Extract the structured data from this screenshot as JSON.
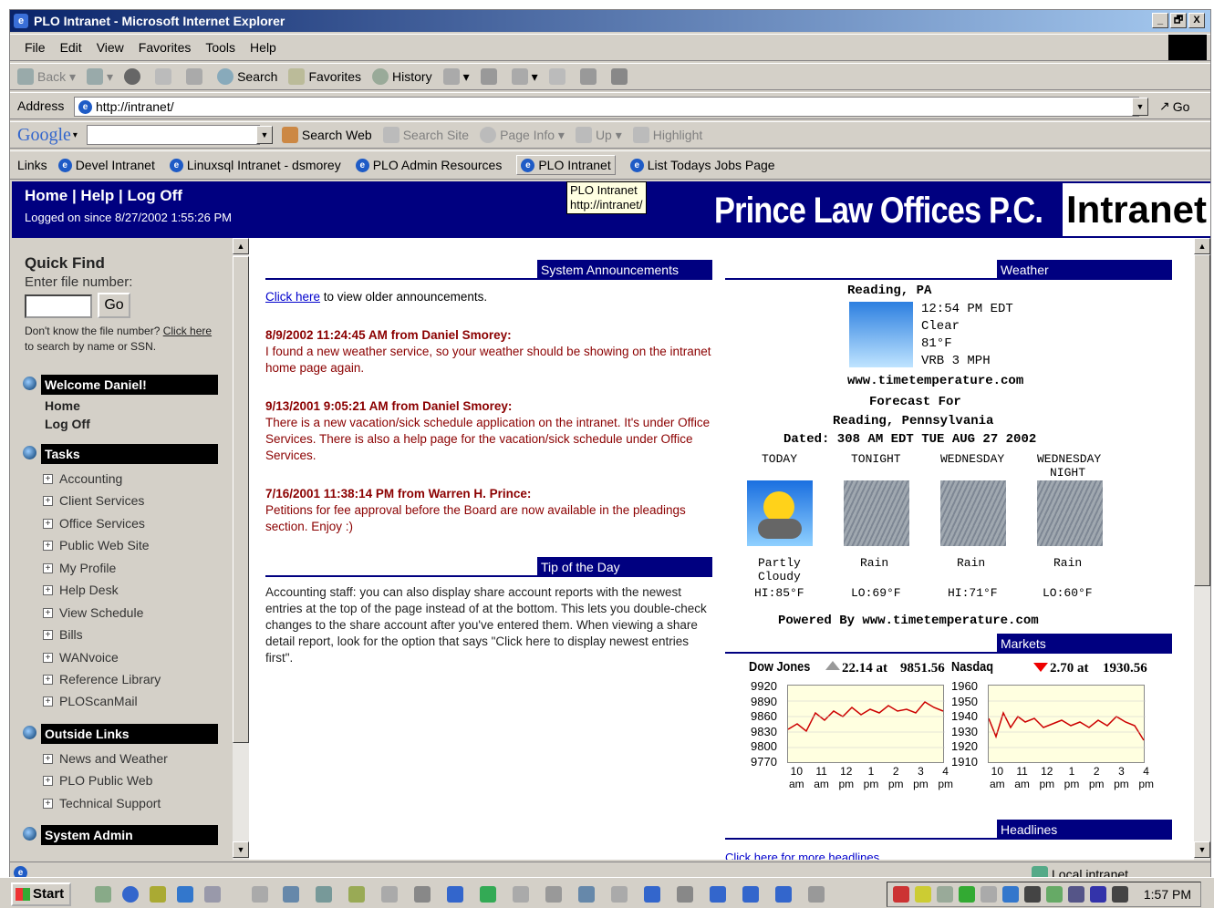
{
  "window": {
    "title": "PLO Intranet - Microsoft Internet Explorer",
    "min": "_",
    "max": "🗗",
    "close": "X"
  },
  "menu": [
    "File",
    "Edit",
    "View",
    "Favorites",
    "Tools",
    "Help"
  ],
  "toolbar": {
    "back": "Back",
    "search": "Search",
    "favorites": "Favorites",
    "history": "History"
  },
  "address": {
    "label": "Address",
    "url": "http://intranet/",
    "go": "Go"
  },
  "google": {
    "logo": "Google",
    "search_web": "Search Web",
    "search_site": "Search Site",
    "page_info": "Page Info",
    "up": "Up",
    "highlight": "Highlight"
  },
  "links": {
    "label": "Links",
    "items": [
      "Devel Intranet",
      "Linuxsql Intranet - dsmorey",
      "PLO Admin Resources",
      "PLO Intranet",
      "List Todays Jobs Page"
    ]
  },
  "tooltip": {
    "line1": "PLO Intranet",
    "line2": "http://intranet/"
  },
  "header": {
    "nav": "Home | Help | Log Off",
    "logon": "Logged on since 8/27/2002 1:55:26 PM",
    "brand": "Prince Law Offices P.C.",
    "intranet": "Intranet"
  },
  "sidebar": {
    "quickfind": "Quick Find",
    "enter": "Enter file number:",
    "go": "Go",
    "dontknow": "Don't know the file number?",
    "clickhere": "Click here",
    "tosearch": "to search by name or SSN.",
    "welcome": "Welcome Daniel!",
    "home": "Home",
    "logoff": "Log Off",
    "tasks": "Tasks",
    "task_items": [
      "Accounting",
      "Client Services",
      "Office Services",
      "Public Web Site",
      "My Profile",
      "Help Desk",
      "View Schedule",
      "Bills",
      "WANvoice",
      "Reference Library",
      "PLOScanMail"
    ],
    "outside": "Outside Links",
    "outside_items": [
      "News and Weather",
      "PLO Public Web",
      "Technical Support"
    ],
    "sysadmin": "System Admin"
  },
  "announcements": {
    "title": "System Announcements",
    "clickhere": "Click here",
    "older": " to view older announcements.",
    "items": [
      {
        "head": "8/9/2002 11:24:45 AM from Daniel Smorey:",
        "body": "I found a new weather service, so your weather should be showing on the intranet home page again."
      },
      {
        "head": "9/13/2001 9:05:21 AM from Daniel Smorey:",
        "body": "There is a new vacation/sick schedule application on the intranet. It's under Office Services. There is also a help page for the vacation/sick schedule under Office Services."
      },
      {
        "head": "7/16/2001 11:38:14 PM from Warren H. Prince:",
        "body": "Petitions for fee approval before the Board are now available in the pleadings section. Enjoy :)"
      }
    ]
  },
  "tip": {
    "title": "Tip of the Day",
    "body": "Accounting staff: you can also display share account reports with the newest entries at the top of the page instead of at the bottom. This lets you double-check changes to the share account after you've entered them. When viewing a share detail report, look for the option that says \"Click here to display newest entries first\"."
  },
  "weather": {
    "title": "Weather",
    "city": "Reading, PA",
    "time": "12:54 PM EDT",
    "cond": "Clear",
    "temp": "81°F",
    "wind": "VRB 3 MPH",
    "site": "www.timetemperature.com",
    "forecast_for": "Forecast For",
    "location": "Reading, Pennsylvania",
    "dated": "Dated: 308 AM EDT TUE AUG 27 2002",
    "days": [
      {
        "name": "TODAY",
        "name2": "",
        "cond": "Partly",
        "cond2": "Cloudy",
        "temp": "HI:85°F"
      },
      {
        "name": "TONIGHT",
        "name2": "",
        "cond": "Rain",
        "cond2": "",
        "temp": "LO:69°F"
      },
      {
        "name": "WEDNESDAY",
        "name2": "",
        "cond": "Rain",
        "cond2": "",
        "temp": "HI:71°F"
      },
      {
        "name": "WEDNESDAY",
        "name2": "NIGHT",
        "cond": "Rain",
        "cond2": "",
        "temp": "LO:60°F"
      }
    ],
    "powered": "Powered By www.timetemperature.com"
  },
  "markets": {
    "title": "Markets",
    "dow": {
      "name": "Dow Jones",
      "change": "22.14 at",
      "value": "9851.56",
      "y": [
        "9920",
        "9890",
        "9860",
        "9830",
        "9800",
        "9770"
      ]
    },
    "nasdaq": {
      "name": "Nasdaq",
      "change": "2.70 at",
      "value": "1930.56",
      "y": [
        "1960",
        "1950",
        "1940",
        "1930",
        "1920",
        "1910"
      ]
    },
    "xh": [
      "10",
      "11",
      "12",
      "1",
      "2",
      "3",
      "4"
    ],
    "xa": [
      "am",
      "am",
      "pm",
      "pm",
      "pm",
      "pm",
      "pm"
    ]
  },
  "headlines": {
    "title": "Headlines",
    "more": "Click here for more headlines"
  },
  "status": {
    "zone": "Local intranet"
  },
  "taskbar": {
    "start": "Start",
    "clock": "1:57 PM"
  },
  "colors": {
    "navy": "#000080",
    "annred": "#8b0000",
    "link": "#0000cc"
  }
}
